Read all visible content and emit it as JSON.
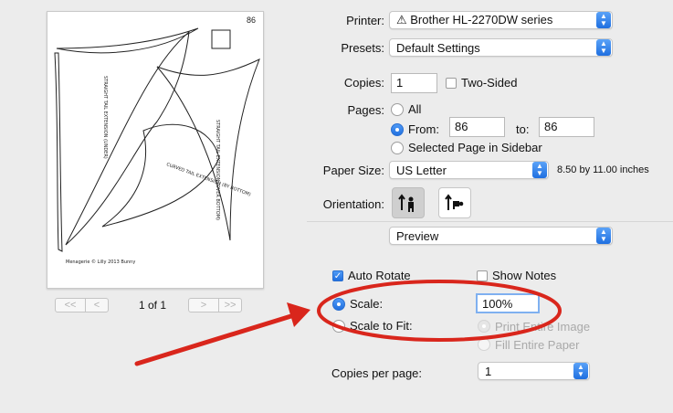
{
  "preview": {
    "page_number": "86",
    "pattern_texts": [
      "STRAIGHT TAIL EXTENSION (UNDER)",
      "STRAIGHT TAIL EXTENSION (OVER BOTTOM)",
      "CURVED TAIL EXTENSION (BY BOTTOM)",
      "Menagerie © Lilly 2013 Bunny"
    ],
    "pager": {
      "first": "<<",
      "prev": "<",
      "next": ">",
      "last": ">>",
      "count": "1 of 1"
    }
  },
  "form": {
    "printer_label": "Printer:",
    "printer_value": "⚠ Brother HL-2270DW series",
    "presets_label": "Presets:",
    "presets_value": "Default Settings",
    "copies_label": "Copies:",
    "copies_value": "1",
    "two_sided_label": "Two-Sided",
    "pages_label": "Pages:",
    "pages_all": "All",
    "pages_from": "From:",
    "pages_from_value": "86",
    "pages_to": "to:",
    "pages_to_value": "86",
    "pages_selected": "Selected Page in Sidebar",
    "paper_size_label": "Paper Size:",
    "paper_size_value": "US Letter",
    "paper_size_dims": "8.50 by 11.00 inches",
    "orientation_label": "Orientation:",
    "section_value": "Preview",
    "auto_rotate": "Auto Rotate",
    "show_notes": "Show Notes",
    "scale_label": "Scale:",
    "scale_value": "100%",
    "scale_to_fit": "Scale to Fit:",
    "print_entire_image": "Print Entire Image",
    "fill_entire_paper": "Fill Entire Paper",
    "copies_per_page_label": "Copies per page:",
    "copies_per_page_value": "1"
  },
  "annotation": {
    "color": "#d9261c"
  }
}
